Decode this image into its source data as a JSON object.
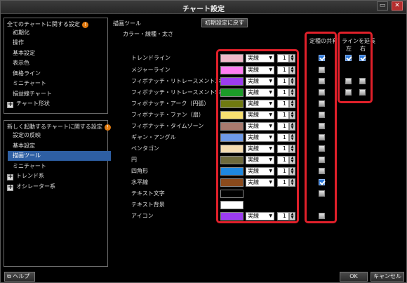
{
  "window": {
    "title": "チャート設定",
    "minimize_glyph": "▭",
    "close_glyph": "✕"
  },
  "left_panel_1": {
    "title": "全てのチャートに関する設定",
    "badge": "!",
    "items": [
      "初期化",
      "操作",
      "基本設定",
      "表示色",
      "価格ライン",
      "ミニチャート",
      "損益線チャート",
      "チャート形状"
    ]
  },
  "left_panel_2": {
    "title": "新しく起動するチャートに関する設定",
    "badge": "!",
    "items": [
      "設定の反映",
      "基本設定",
      "描画ツール",
      "ミニチャート",
      "トレンド系",
      "オシレーター系"
    ]
  },
  "main": {
    "section_title": "描画ツール",
    "sub_title": "カラー・線種・太さ",
    "reset_button": "初期設定に戻す",
    "header_shared": "定種の共有",
    "header_extend": "ラインを延長",
    "header_left": "左",
    "header_right": "右",
    "rows": [
      {
        "label": "トレンドライン",
        "color": "#f0b8c8",
        "style": "実線",
        "width": "1",
        "shared": true,
        "left": true,
        "right": true
      },
      {
        "label": "メジャーライン",
        "color": "#ff7ef2",
        "style": "実線",
        "width": "1",
        "shared": false
      },
      {
        "label": "フィボナッチ・リトレースメント3本",
        "color": "#9c3cf0",
        "style": "実線",
        "width": "1",
        "shared": false,
        "left": false,
        "right": false
      },
      {
        "label": "フィボナッチ・リトレースメント5本",
        "color": "#1c9c28",
        "style": "実線",
        "width": "1",
        "shared": false,
        "left": false,
        "right": false
      },
      {
        "label": "フィボナッチ・アーク（円弧）",
        "color": "#6f7a10",
        "style": "実線",
        "width": "1",
        "shared": false
      },
      {
        "label": "フィボナッチ・ファン（扇）",
        "color": "#f8e070",
        "style": "実線",
        "width": "1",
        "shared": false
      },
      {
        "label": "フィボナッチ・タイムゾーン",
        "color": "#a87a6e",
        "style": "実線",
        "width": "1",
        "shared": false
      },
      {
        "label": "ギャン・アングル",
        "color": "#6e9ae8",
        "style": "実線",
        "width": "1",
        "shared": false
      },
      {
        "label": "ペンタゴン",
        "color": "#f5dcb0",
        "style": "実線",
        "width": "1",
        "shared": false
      },
      {
        "label": "円",
        "color": "#6e6a3c",
        "style": "実線",
        "width": "1",
        "shared": false
      },
      {
        "label": "四角形",
        "color": "#1e88e0",
        "style": "実線",
        "width": "1",
        "shared": false
      },
      {
        "label": "水平線",
        "color": "#8a4a1c",
        "style": "実線",
        "width": "1",
        "shared": true
      },
      {
        "label": "テキスト文字",
        "color": "#000000",
        "shared": false
      },
      {
        "label": "テキスト背景",
        "color": "#ffffff"
      },
      {
        "label": "アイコン",
        "color": "#9c3cf0",
        "style": "実線",
        "width": "1",
        "shared": false
      }
    ]
  },
  "footer": {
    "help": "ヘルプ",
    "ok": "OK",
    "cancel": "キャンセル"
  },
  "colors": {
    "highlight": "#e0202a",
    "selection": "#2e5fa3",
    "badge": "#e07a10",
    "check_on": "#2c78d8"
  }
}
